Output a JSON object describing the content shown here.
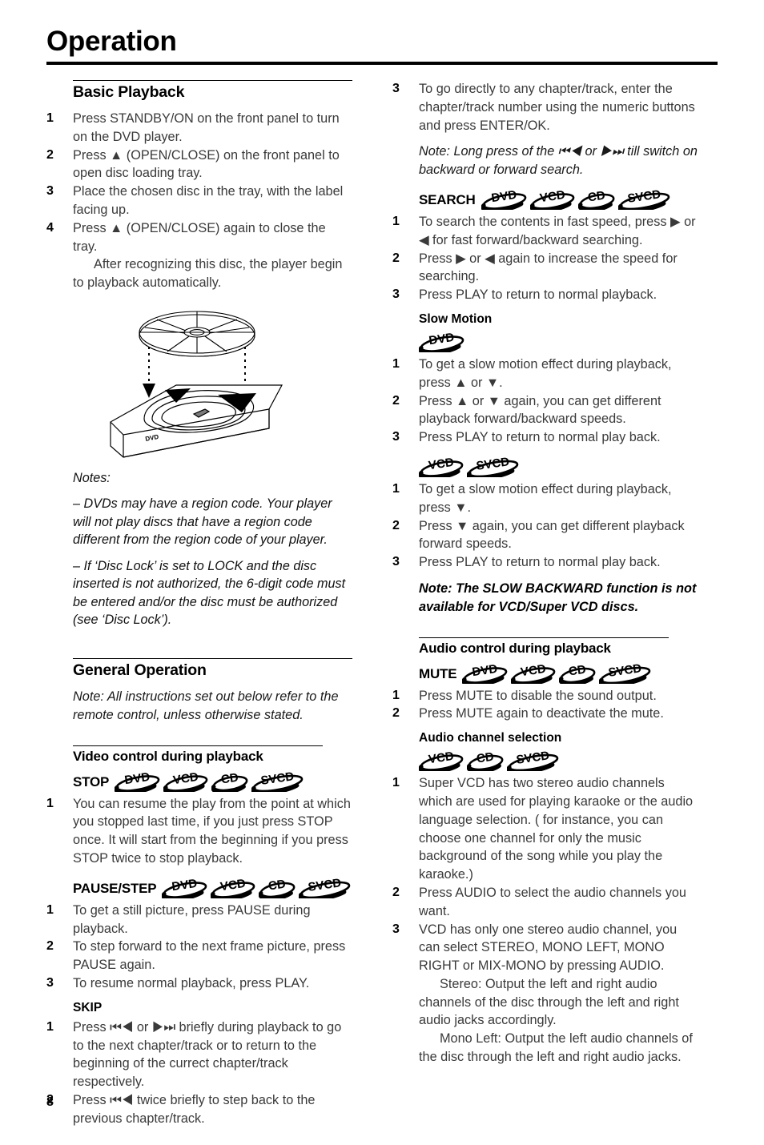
{
  "header": {
    "title": "Operation"
  },
  "page_number": "8",
  "badges": {
    "dvd": "DVD",
    "vcd": "VCD",
    "cd": "CD",
    "svcd": "SVCD"
  },
  "left_column": {
    "basic_playback": {
      "heading": "Basic Playback",
      "steps": [
        {
          "num": "1",
          "text": "Press STANDBY/ON on the front panel to turn on the DVD player."
        },
        {
          "num": "2",
          "text": "Press ▲ (OPEN/CLOSE) on the front panel to open disc loading tray."
        },
        {
          "num": "3",
          "text": "Place the chosen disc in the tray, with the label facing up."
        },
        {
          "num": "4",
          "text": "Press ▲ (OPEN/CLOSE) again to close the tray.",
          "cont": "After recognizing this disc, the player begin to playback automatically."
        }
      ]
    },
    "figure": {
      "name": "dvd-tray-illustration",
      "disc_label": "DVD"
    },
    "notes": {
      "title": "Notes:",
      "items": [
        "–  DVDs may have a region code. Your player will not play discs that have a region code different from the region code of your player.",
        "–  If ‘Disc Lock’ is set to LOCK and the disc inserted is not authorized, the 6-digit code must be entered and/or the disc must be authorized (see ‘Disc Lock’)."
      ]
    },
    "general_operation": {
      "heading": "General Operation",
      "note": "Note: All instructions set out below refer to the remote control, unless otherwise stated."
    },
    "video_control": {
      "heading": "Video control during playback",
      "stop": {
        "label": "STOP",
        "badges": [
          "DVD",
          "VCD",
          "CD",
          "SVCD"
        ],
        "steps": [
          {
            "num": "1",
            "text": "You can resume the play from the point at which you stopped last time, if you just press STOP once. It will start from the beginning if you press STOP twice to stop playback."
          }
        ]
      },
      "pause_step": {
        "label": "PAUSE/STEP",
        "badges": [
          "DVD",
          "VCD",
          "CD",
          "SVCD"
        ],
        "steps": [
          {
            "num": "1",
            "text": "To get a still picture, press PAUSE during playback."
          },
          {
            "num": "2",
            "text": "To step forward to the next frame picture, press PAUSE again."
          },
          {
            "num": "3",
            "text": "To resume normal playback, press PLAY."
          }
        ]
      },
      "skip": {
        "label": "SKIP",
        "steps": [
          {
            "num": "1",
            "text": "Press ⏮◀ or ▶⏭ briefly during playback to go to the next chapter/track or to return to the beginning of the currect chapter/track respectively."
          },
          {
            "num": "2",
            "text": "Press ⏮◀ twice briefly to step back to the previous chapter/track."
          }
        ]
      }
    }
  },
  "right_column": {
    "skip_continued": {
      "steps": [
        {
          "num": "3",
          "text": "To go directly to any chapter/track, enter the chapter/track number using the numeric buttons and press ENTER/OK."
        }
      ],
      "note": "Note: Long press of the ⏮◀ or ▶⏭ till switch on backward or forward search."
    },
    "search": {
      "label": "SEARCH",
      "badges": [
        "DVD",
        "VCD",
        "CD",
        "SVCD"
      ],
      "steps": [
        {
          "num": "1",
          "text": "To search the contents in fast speed, press ▶ or ◀ for fast forward/backward searching."
        },
        {
          "num": "2",
          "text": "Press ▶ or ◀ again to increase the speed for searching."
        },
        {
          "num": "3",
          "text": "Press PLAY to return to normal playback."
        }
      ]
    },
    "slow_motion": {
      "heading": "Slow Motion",
      "dvd_block": {
        "badges": [
          "DVD"
        ],
        "steps": [
          {
            "num": "1",
            "text": "To get a slow motion effect during playback, press ▲ or ▼."
          },
          {
            "num": "2",
            "text": "Press ▲ or ▼ again, you can get different playback forward/backward speeds."
          },
          {
            "num": "3",
            "text": "Press PLAY to return to normal play back."
          }
        ]
      },
      "vcd_block": {
        "badges": [
          "VCD",
          "SVCD"
        ],
        "steps": [
          {
            "num": "1",
            "text": "To get a slow motion effect during playback, press ▼."
          },
          {
            "num": "2",
            "text": "Press ▼ again, you can get different playback forward speeds."
          },
          {
            "num": "3",
            "text": "Press PLAY to return to normal play back."
          }
        ]
      },
      "note": "Note: The SLOW BACKWARD function is not available for VCD/Super VCD discs."
    },
    "audio_control": {
      "heading": "Audio control during playback",
      "mute": {
        "label": "MUTE",
        "badges": [
          "DVD",
          "VCD",
          "CD",
          "SVCD"
        ],
        "steps": [
          {
            "num": "1",
            "text": "Press MUTE to disable the sound output."
          },
          {
            "num": "2",
            "text": "Press MUTE again to deactivate the mute."
          }
        ]
      },
      "audio_channel": {
        "heading": "Audio channel selection",
        "badges": [
          "VCD",
          "CD",
          "SVCD"
        ],
        "steps": [
          {
            "num": "1",
            "text": "Super VCD has two stereo audio channels which are used for playing karaoke or the audio language selection. ( for instance, you can choose one channel for only the music background of the song while you play the karaoke.)"
          },
          {
            "num": "2",
            "text": "Press AUDIO to select the audio channels you want."
          },
          {
            "num": "3",
            "text": "VCD has only one stereo audio channel, you can select STEREO, MONO LEFT, MONO RIGHT or MIX-MONO by pressing AUDIO.",
            "cont1": "Stereo: Output the left and right audio channels of the disc through the left and right audio jacks accordingly.",
            "cont2": "Mono Left: Output the left audio channels of the disc through the left and right audio jacks."
          }
        ]
      }
    }
  }
}
